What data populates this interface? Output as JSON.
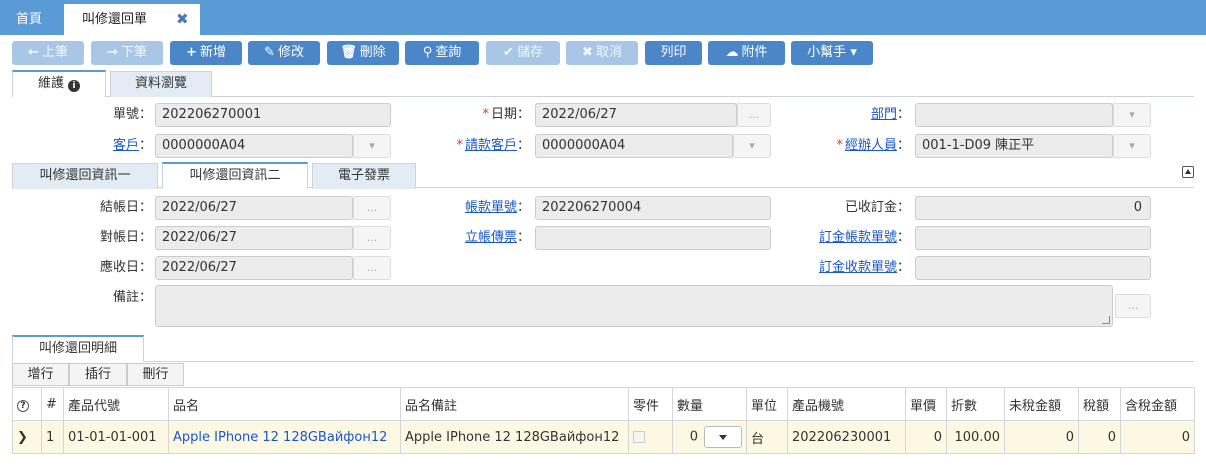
{
  "top_tabs": {
    "home": "首頁",
    "active": "叫修還回單",
    "close": "✖"
  },
  "toolbar": {
    "prev": "上筆",
    "next": "下筆",
    "add": "新增",
    "edit": "修改",
    "delete": "刪除",
    "query": "查詢",
    "save": "儲存",
    "cancel": "取消",
    "print": "列印",
    "attach": "附件",
    "helper": "小幫手"
  },
  "form_tabs": {
    "maintain": "維護",
    "browse": "資料瀏覽"
  },
  "header": {
    "doc_no_label": "單號",
    "doc_no": "202206270001",
    "date_label": "日期",
    "date": "2022/06/27",
    "dept_label": "部門",
    "dept": "",
    "customer_label": "客戶",
    "customer": "0000000A04",
    "pay_customer_label": "請款客戶",
    "pay_customer": "0000000A04",
    "handler_label": "經辦人員",
    "handler": "001-1-D09 陳正平",
    "colon": "："
  },
  "sub_tabs": {
    "t1": "叫修還回資訊一",
    "t2": "叫修還回資訊二",
    "t3": "電子發票"
  },
  "info2": {
    "close_date_label": "結帳日",
    "close_date": "2022/06/27",
    "reconcile_date_label": "對帳日",
    "reconcile_date": "2022/06/27",
    "receivable_date_label": "應收日",
    "receivable_date": "2022/06/27",
    "account_no_label": "帳款單號",
    "account_no": "202206270004",
    "voucher_label": "立帳傳票",
    "voucher": "",
    "deposit_label": "已收訂金",
    "deposit": "0",
    "deposit_account_label": "訂金帳款單號",
    "deposit_account": "",
    "deposit_receipt_label": "訂金收款單號",
    "deposit_receipt": "",
    "remark_label": "備註",
    "remark": "",
    "addon": "..."
  },
  "detail": {
    "tab": "叫修還回明細",
    "add_row": "增行",
    "insert_row": "插行",
    "delete_row": "刪行",
    "columns": [
      "?",
      "#",
      "產品代號",
      "品名",
      "品名備註",
      "零件",
      "數量",
      "單位",
      "產品機號",
      "單價",
      "折數",
      "未稅金額",
      "稅額",
      "含稅金額"
    ],
    "rows": [
      {
        "marker": "❯",
        "index": "1",
        "code": "01-01-01-001",
        "name": "Apple IPhone 12 128GBайфон12",
        "name_note": "Apple IPhone 12 128GBайфон12",
        "qty": "0",
        "unit": "台",
        "serial": "202206230001",
        "price": "0",
        "discount": "100.00",
        "amount_ex": "0",
        "tax": "0",
        "amount_in": "0"
      }
    ]
  }
}
